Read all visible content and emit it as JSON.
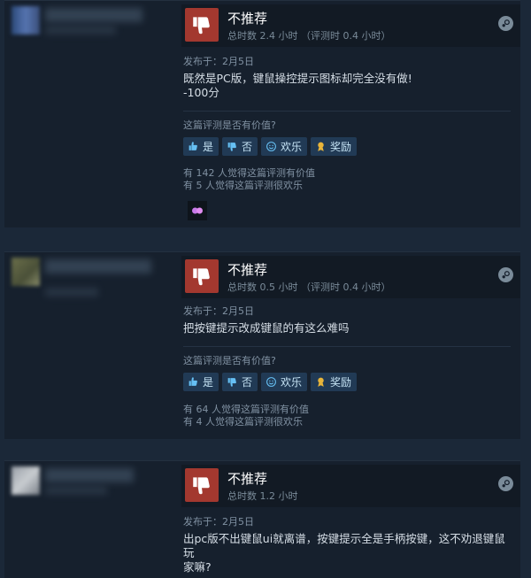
{
  "reviews": [
    {
      "verdict": "不推荐",
      "hours": "总时数 2.4 小时 （评测时 0.4 小时）",
      "posted": "发布于：2月5日",
      "content": [
        "既然是PC版，键鼠操控提示图标却完全没有做!",
        "-100分"
      ],
      "question": "这篇评测是否有价值?",
      "buttons": {
        "yes": "是",
        "no": "否",
        "funny": "欢乐",
        "award": "奖励"
      },
      "counts": [
        "有 142 人觉得这篇评测有价值",
        "有 5 人觉得这篇评测很欢乐"
      ]
    },
    {
      "verdict": "不推荐",
      "hours": "总时数 0.5 小时 （评测时 0.4 小时）",
      "posted": "发布于：2月5日",
      "content": [
        "把按键提示改成键鼠的有这么难吗"
      ],
      "question": "这篇评测是否有价值?",
      "buttons": {
        "yes": "是",
        "no": "否",
        "funny": "欢乐",
        "award": "奖励"
      },
      "counts": [
        "有 64 人觉得这篇评测有价值",
        "有 4 人觉得这篇评测很欢乐"
      ]
    },
    {
      "verdict": "不推荐",
      "hours": "总时数 1.2 小时",
      "posted": "发布于：2月5日",
      "content": [
        "出pc版不出键鼠ui就离谱，按键提示全是手柄按键，这不劝退键鼠玩",
        "家嘛?"
      ]
    }
  ],
  "colors": {
    "thumb_bg": "#a3382f",
    "accent": "#66c0f4",
    "page_bg": "#1b2838"
  },
  "icons": {
    "verdict": "thumbs-down-icon",
    "platform": "steam-icon",
    "award_badge": "sparkle-award-icon"
  }
}
